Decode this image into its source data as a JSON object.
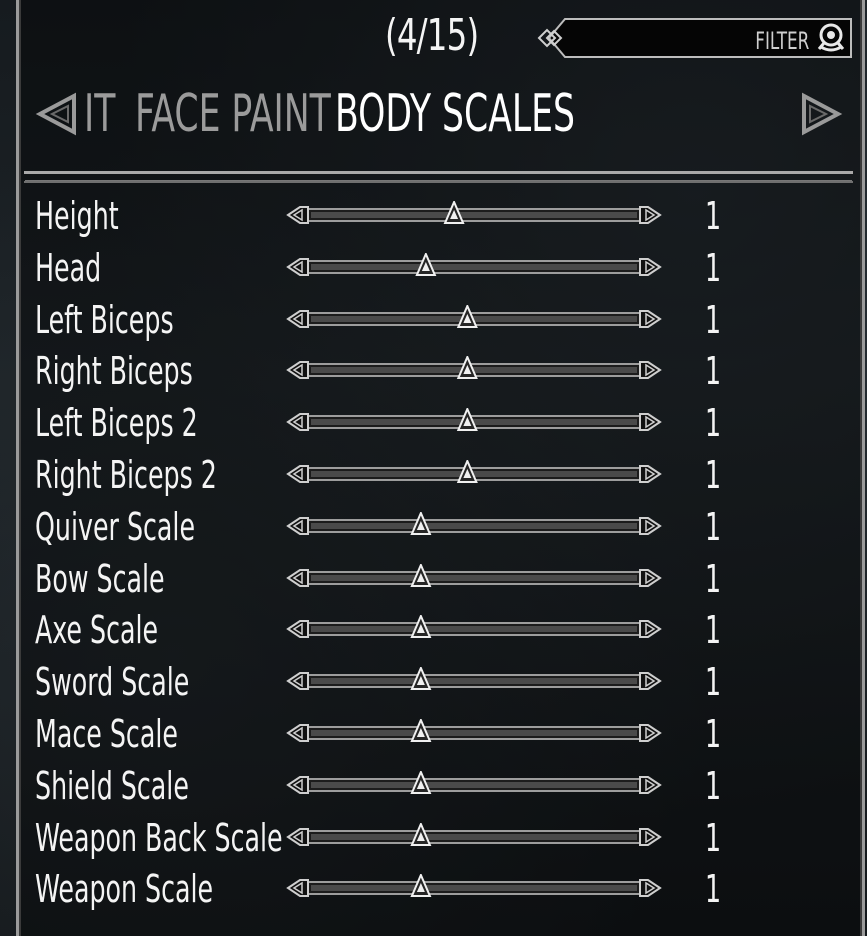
{
  "header": {
    "counter": "(4/15)",
    "filter_label": "FILTER",
    "filter_icon": "search-icon"
  },
  "tabs": {
    "prev_icon": "chevron-left-icon",
    "next_icon": "chevron-right-icon",
    "items": [
      {
        "label": "IT",
        "active": false
      },
      {
        "label": "FACE PAINT",
        "active": false
      },
      {
        "label": "BODY SCALES",
        "active": true
      }
    ]
  },
  "sliders": [
    {
      "label": "Height",
      "value": "1",
      "position": 0.44
    },
    {
      "label": "Head",
      "value": "1",
      "position": 0.355
    },
    {
      "label": "Left Biceps",
      "value": "1",
      "position": 0.48
    },
    {
      "label": "Right Biceps",
      "value": "1",
      "position": 0.48
    },
    {
      "label": "Left Biceps 2",
      "value": "1",
      "position": 0.48
    },
    {
      "label": "Right Biceps 2",
      "value": "1",
      "position": 0.48
    },
    {
      "label": "Quiver Scale",
      "value": "1",
      "position": 0.34
    },
    {
      "label": "Bow Scale",
      "value": "1",
      "position": 0.34
    },
    {
      "label": "Axe Scale",
      "value": "1",
      "position": 0.34
    },
    {
      "label": "Sword Scale",
      "value": "1",
      "position": 0.34
    },
    {
      "label": "Mace Scale",
      "value": "1",
      "position": 0.34
    },
    {
      "label": "Shield Scale",
      "value": "1",
      "position": 0.34
    },
    {
      "label": "Weapon Back Scale",
      "value": "1",
      "position": 0.34
    },
    {
      "label": "Weapon Scale",
      "value": "1",
      "position": 0.34
    }
  ]
}
